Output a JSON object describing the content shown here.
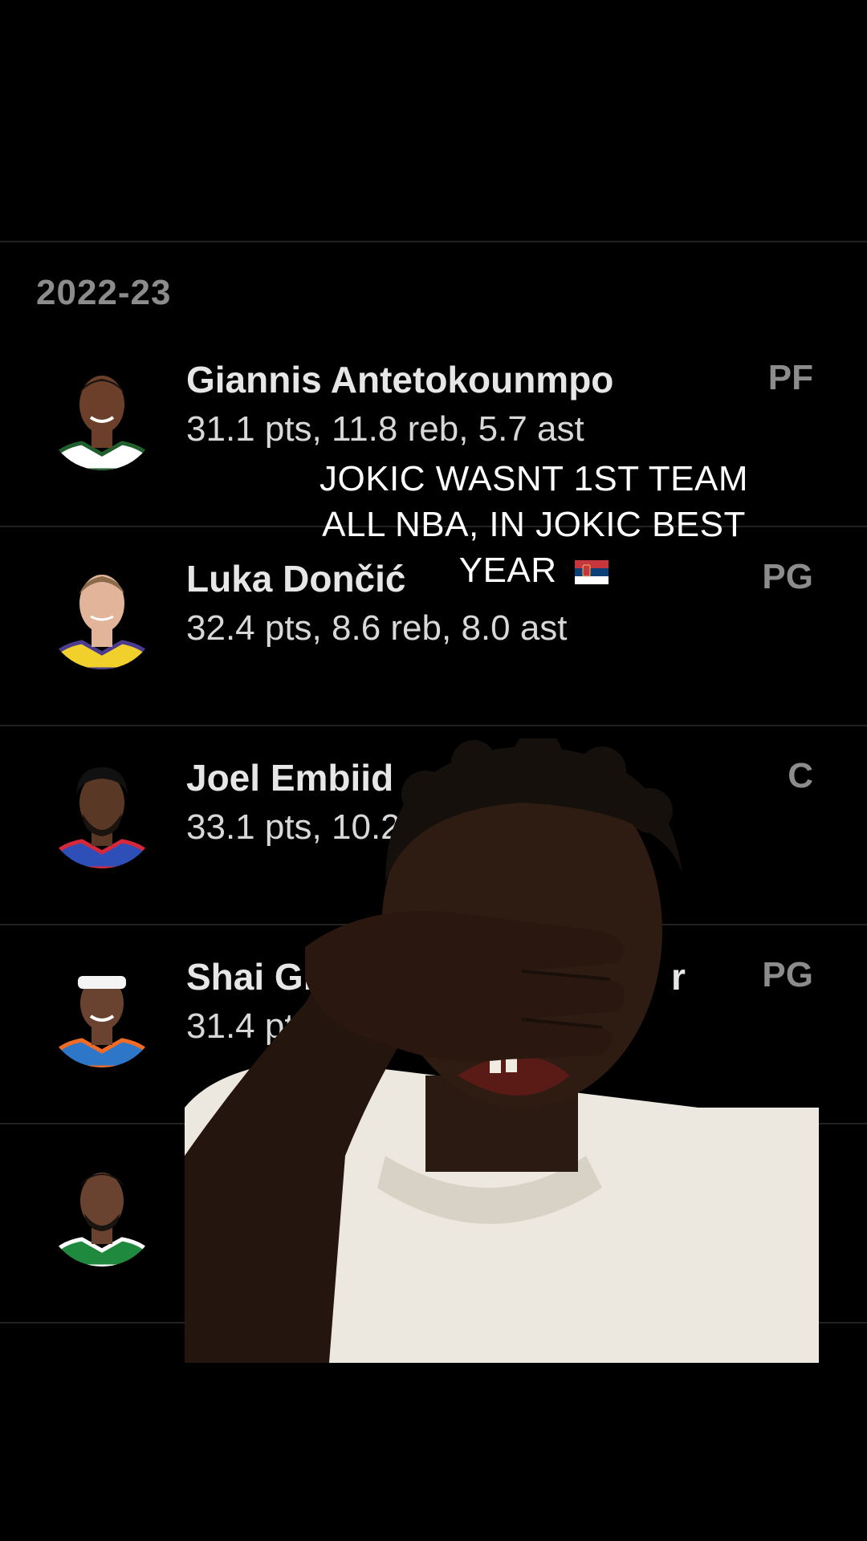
{
  "season_label": "2022-23",
  "players": [
    {
      "name": "Giannis Antetokounmpo",
      "stats": "31.1 pts, 11.8 reb, 5.7 ast",
      "position": "PF",
      "jersey_color": "#ffffff",
      "trim_color": "#1f5f2e"
    },
    {
      "name": "Luka Dončić",
      "stats": "32.4 pts, 8.6 reb, 8.0 ast",
      "position": "PG",
      "jersey_color": "#f2d02c",
      "trim_color": "#4a3b8f"
    },
    {
      "name": "Joel Embiid",
      "stats": "33.1 pts, 10.2",
      "position": "C",
      "jersey_color": "#2e4fb8",
      "trim_color": "#d6283a"
    },
    {
      "name": "Shai Gil",
      "stats": "31.4 pt",
      "position": "PG",
      "jersey_color": "#2e76c7",
      "trim_color": "#f06b25"
    },
    {
      "name": "",
      "stats": "",
      "position": "",
      "jersey_color": "#1f8a3e",
      "trim_color": "#ffffff"
    }
  ],
  "shai_partial_suffix": "r",
  "caption": {
    "line1": "JOKIC WASNT 1ST TEAM",
    "line2": "ALL NBA, IN JOKIC BEST",
    "line3": "YEAR",
    "flag_icon": "serbia-flag-icon"
  },
  "colors": {
    "background": "#000000",
    "divider": "#222222",
    "muted_text": "#8c8c8c",
    "primary_text": "#e6e6e6"
  }
}
